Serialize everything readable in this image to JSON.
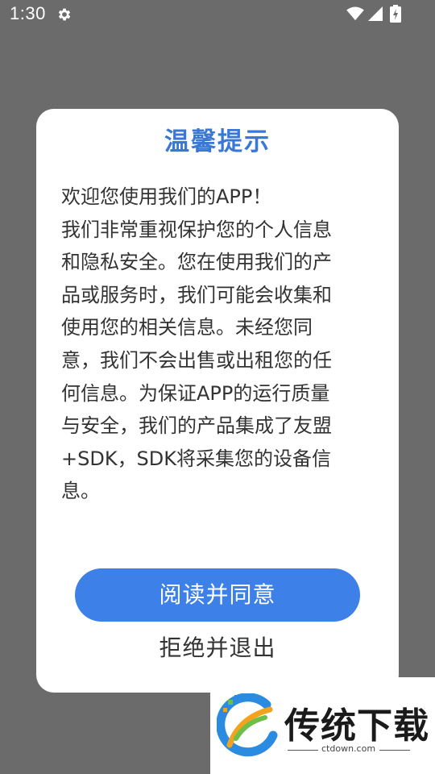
{
  "status_bar": {
    "time": "1:30",
    "icons": [
      "gear-icon",
      "wifi-icon",
      "signal-icon",
      "battery-charging-icon"
    ]
  },
  "dialog": {
    "title": "温馨提示",
    "message": "欢迎您使用我们的APP！\n我们非常重视保护您的个人信息\n和隐私安全。您在使用我们的产\n品或服务时，我们可能会收集和\n使用您的相关信息。未经您同\n意，我们不会出售或出租您的任\n何信息。为保证APP的运行质量\n与安全，我们的产品集成了友盟\n+SDK，SDK将采集您的设备信\n息。",
    "agree_label": "阅读并同意",
    "decline_label": "拒绝并退出"
  },
  "watermark": {
    "title": "传统下载",
    "url": "ctdown.com"
  },
  "colors": {
    "accent": "#3d80e8",
    "title": "#3a78d4",
    "overlay": "#6b6b6b"
  }
}
